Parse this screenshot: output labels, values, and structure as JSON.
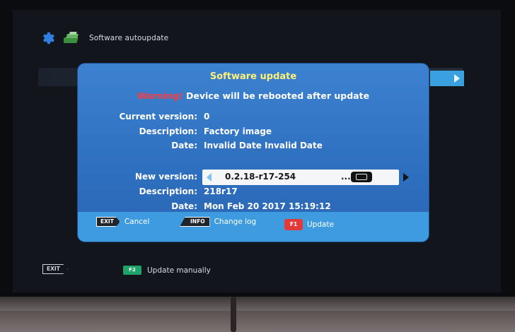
{
  "header": {
    "title": "Software autoupdate",
    "icons": [
      "gear-icon",
      "update-pkg-icon"
    ]
  },
  "dialog": {
    "title": "Software update",
    "warning_prefix": "Warning!",
    "warning_text": " Device will be rebooted after update",
    "current": {
      "version_label": "Current version:",
      "version_value": "0",
      "description_label": "Description:",
      "description_value": "Factory image",
      "date_label": "Date:",
      "date_value": "Invalid Date Invalid Date"
    },
    "new": {
      "version_label": "New version:",
      "version_value": "0.2.18-r17-254",
      "version_ellipsis": "...",
      "description_label": "Description:",
      "description_value": "218r17",
      "date_label": "Date:",
      "date_value": "Mon Feb 20 2017 15:19:12"
    },
    "footer": {
      "exit_key": "EXIT",
      "cancel_label": "Cancel",
      "info_key": "INFO",
      "changelog_label": "Change log",
      "f1_key": "F1",
      "update_label": "Update"
    }
  },
  "bottom": {
    "exit_key": "EXIT",
    "f2_key": "F2",
    "update_manually_label": "Update manually"
  },
  "colors": {
    "dialog_bg": "#2e6fbf",
    "footer_bg": "#3e9be0",
    "title_yellow": "#fff176",
    "warning_red": "#ff3b3b",
    "key_red": "#e23a3a",
    "key_green": "#1fa36a"
  }
}
